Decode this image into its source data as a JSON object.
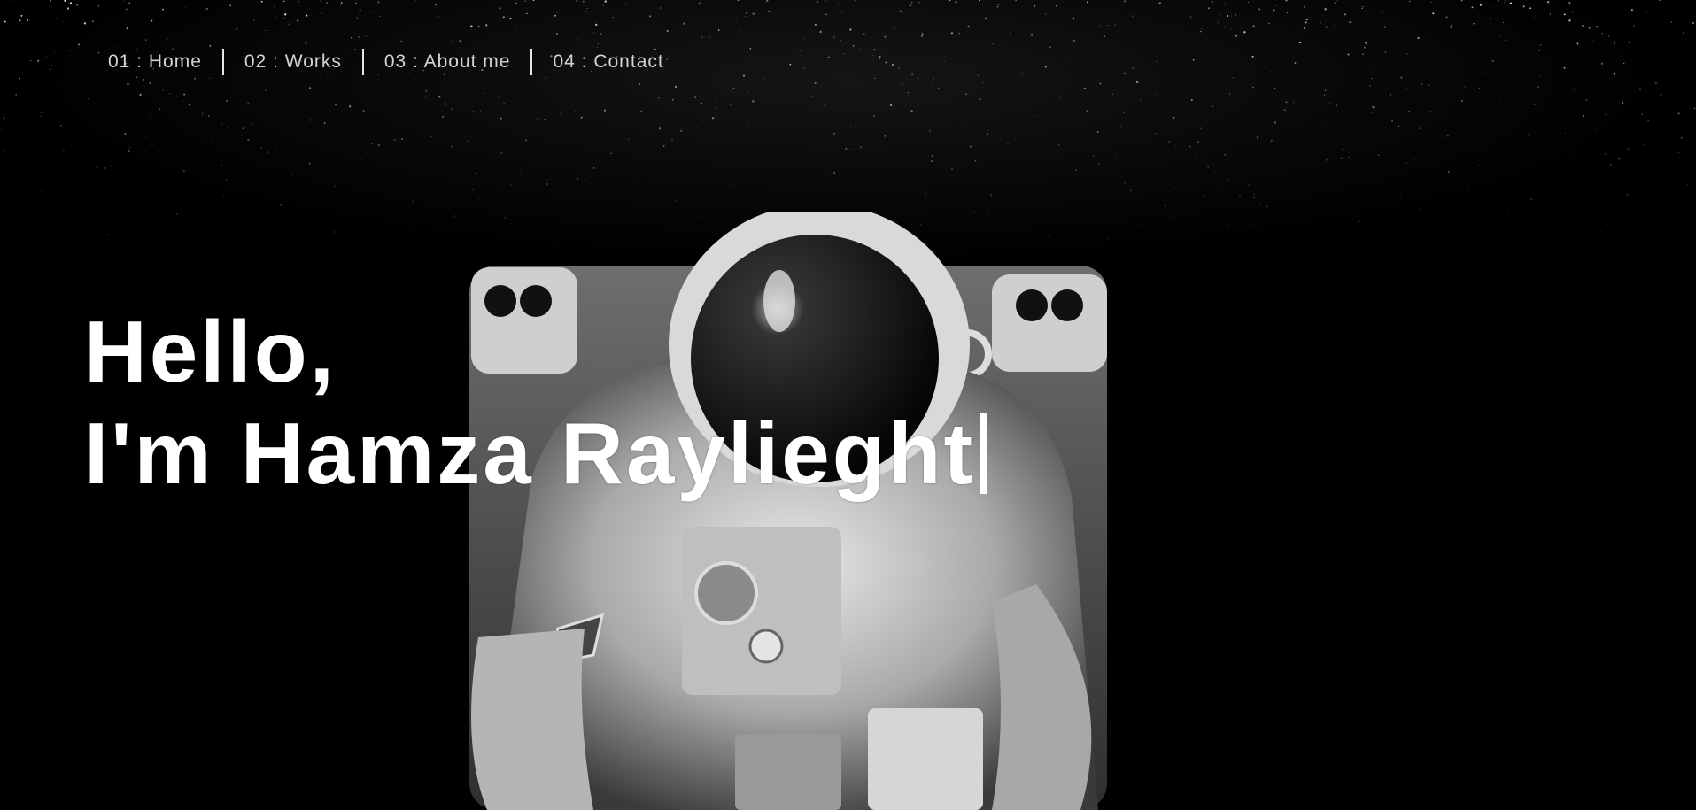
{
  "nav": {
    "items": [
      {
        "label": "01 : Home"
      },
      {
        "label": "02 : Works"
      },
      {
        "label": "03 : About me"
      },
      {
        "label": "04 : Contact"
      }
    ]
  },
  "hero": {
    "line1": "Hello,",
    "line2": "I'm Hamza Raylieght",
    "cursor": "|"
  },
  "background": {
    "image": "astronaut-in-space",
    "color": "#000000",
    "text_color": "#ffffff"
  }
}
